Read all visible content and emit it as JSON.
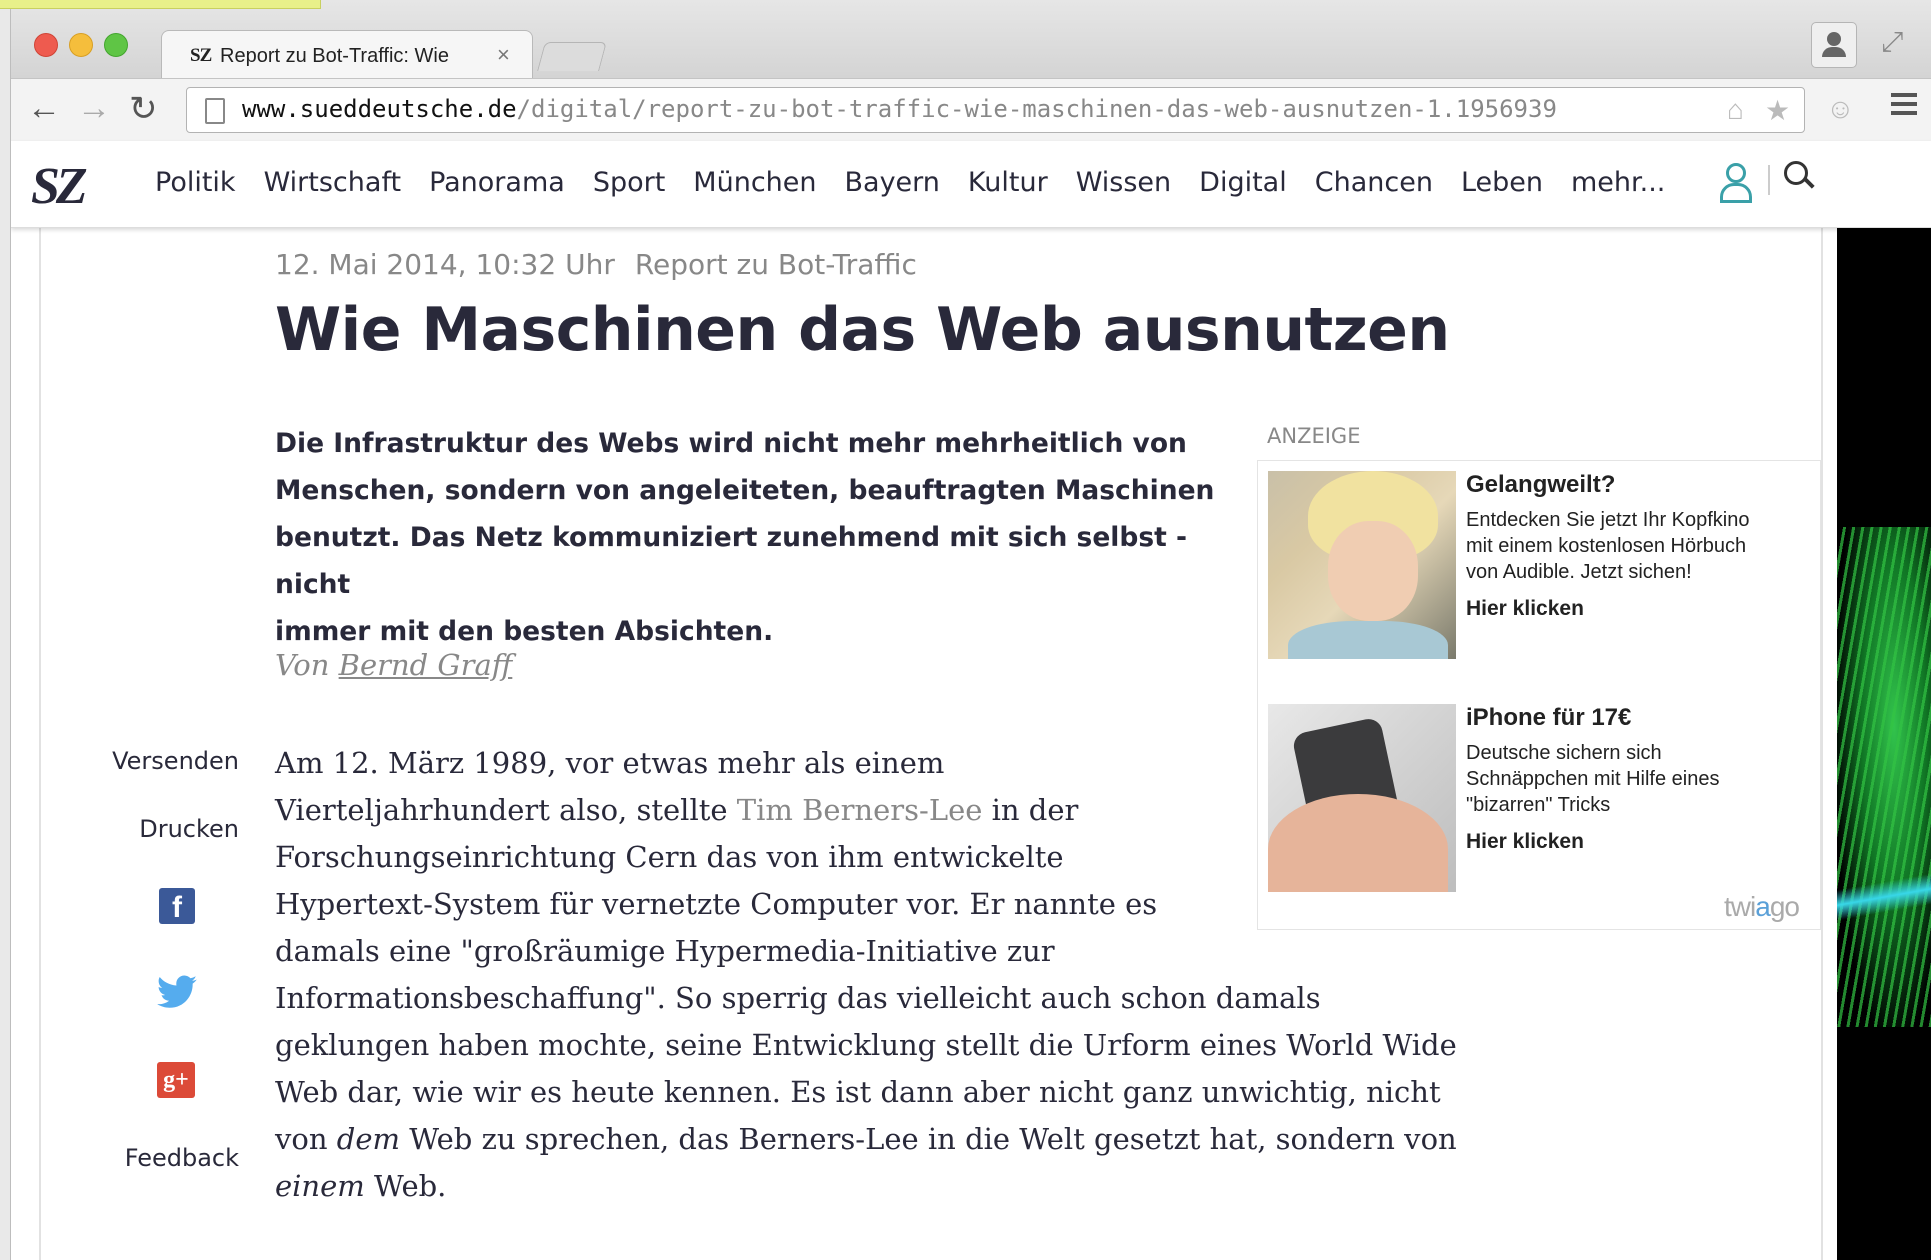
{
  "browser": {
    "tab_favicon": "SZ",
    "tab_title": "Report zu Bot-Traffic: Wie",
    "tab_close": "×",
    "url_host": "www.sueddeutsche.de",
    "url_path": "/digital/report-zu-bot-traffic-wie-maschinen-das-web-ausnutzen-1.1956939"
  },
  "site": {
    "logo": "SZ",
    "nav": [
      "Politik",
      "Wirtschaft",
      "Panorama",
      "Sport",
      "München",
      "Bayern",
      "Kultur",
      "Wissen",
      "Digital",
      "Chancen",
      "Leben",
      "mehr..."
    ]
  },
  "article": {
    "date": "12. Mai 2014, 10:32 Uhr",
    "topic": "Report zu Bot-Traffic",
    "headline": "Wie Maschinen das Web ausnutzen",
    "teaser_lines": [
      "Die Infrastruktur des Webs wird nicht mehr mehrheitlich von",
      "Menschen, sondern von angeleiteten, beauftragten Maschinen",
      "benutzt. Das Netz kommuniziert zunehmend mit sich selbst - nicht",
      "immer mit den besten Absichten."
    ],
    "author_prefix": "Von ",
    "author_name": "Bernd Graff",
    "body": {
      "l1": "Am 12. März 1989, vor etwas mehr als einem",
      "l2a": "Vierteljahrhundert also, stellte ",
      "l2link": "Tim Berners-Lee",
      "l2b": " in der",
      "l3": "Forschungseinrichtung Cern das von ihm entwickelte",
      "l4": "Hypertext-System für vernetzte Computer vor. Er nannte es",
      "l5": "damals eine \"großräumige Hypermedia-Initiative zur",
      "l6": "Informationsbeschaffung\". So sperrig das vielleicht auch schon damals",
      "l7": "geklungen haben mochte, seine Entwicklung stellt die Urform eines World Wide",
      "l8": "Web dar, wie wir es heute kennen. Es ist dann aber nicht ganz unwichtig, nicht",
      "l9a": "von ",
      "l9em": "dem",
      "l9b": " Web zu sprechen, das Berners-Lee in die Welt gesetzt hat, sondern von",
      "l10em": "einem",
      "l10b": " Web."
    }
  },
  "share": {
    "send": "Versenden",
    "print": "Drucken",
    "facebook_glyph": "f",
    "googleplus_glyph": "g+",
    "feedback": "Feedback"
  },
  "ad": {
    "label": "ANZEIGE",
    "items": [
      {
        "title": "Gelangweilt?",
        "lines": [
          "Entdecken Sie jetzt Ihr Kopfkino",
          "mit einem kostenlosen Hörbuch",
          "von Audible. Jetzt sichen!"
        ],
        "cta": "Hier klicken"
      },
      {
        "title": "iPhone für 17€",
        "lines": [
          "Deutsche sichern sich",
          "Schnäppchen mit Hilfe eines",
          "\"bizarren\" Tricks"
        ],
        "cta": "Hier klicken"
      }
    ],
    "brand_a": "twi",
    "brand_b": "a",
    "brand_c": "go"
  }
}
